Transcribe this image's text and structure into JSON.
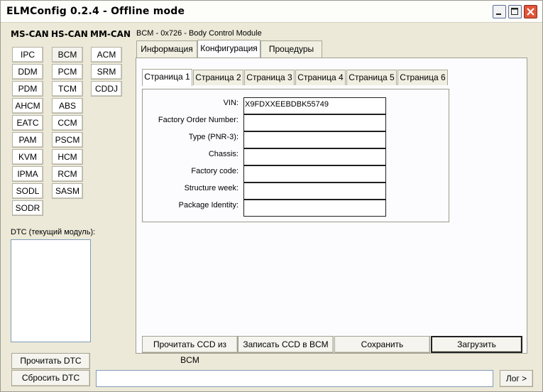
{
  "window": {
    "title": "ELMConfig 0.2.4 - Offline mode"
  },
  "groups": {
    "ms_can": "MS-CAN",
    "hs_can": "HS-CAN",
    "mm_can": "MM-CAN"
  },
  "ms_can_modules": [
    "IPC",
    "DDM",
    "PDM",
    "AHCM",
    "EATC",
    "PAM",
    "KVM",
    "IPMA",
    "SODL",
    "SODR"
  ],
  "hs_can_modules": [
    "BCM",
    "PCM",
    "TCM",
    "ABS",
    "CCM",
    "PSCM",
    "HCM",
    "RCM",
    "SASM"
  ],
  "mm_can_modules": [
    "ACM",
    "SRM",
    "CDDJ"
  ],
  "active_module": "BCM",
  "dtc": {
    "label": "DTC (текущий модуль):",
    "read_button": "Прочитать DTC",
    "reset_button": "Сбросить DTC"
  },
  "module_title": "BCM - 0x726 - Body Control Module",
  "tabs": [
    "Информация",
    "Конфигурация",
    "Процедуры"
  ],
  "active_tab": "Конфигурация",
  "subtabs": [
    "Страница 1",
    "Страница 2",
    "Страница 3",
    "Страница 4",
    "Страница 5",
    "Страница 6"
  ],
  "active_subtab": "Страница 1",
  "fields": [
    {
      "label": "VIN:",
      "value": "X9FDXXEEBDBK55749"
    },
    {
      "label": "Factory Order Number:",
      "value": ""
    },
    {
      "label": "Type (PNR-3):",
      "value": ""
    },
    {
      "label": "Chassis:",
      "value": ""
    },
    {
      "label": "Factory code:",
      "value": ""
    },
    {
      "label": "Structure week:",
      "value": ""
    },
    {
      "label": "Package Identity:",
      "value": ""
    }
  ],
  "actions": {
    "read_ccd": "Прочитать CCD из BCM",
    "write_ccd": "Записать CCD в BCM",
    "save": "Сохранить",
    "load": "Загрузить"
  },
  "status": {
    "text": ""
  },
  "log_button": "Лог >"
}
